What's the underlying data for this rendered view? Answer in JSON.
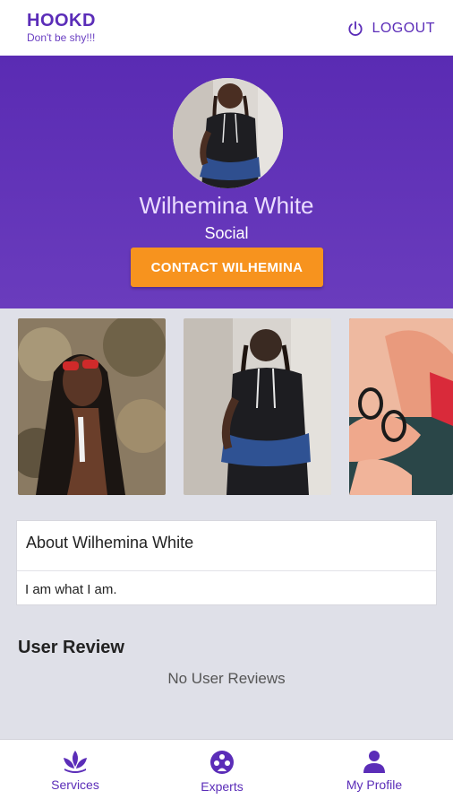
{
  "app": {
    "title": "HOOKD",
    "tagline": "Don't be shy!!!",
    "logout_label": "LOGOUT"
  },
  "profile": {
    "name": "Wilhemina White",
    "category": "Social",
    "contact_button": "CONTACT WILHEMINA"
  },
  "about": {
    "title": "About Wilhemina White",
    "text": "I am what I am."
  },
  "reviews": {
    "heading": "User Review",
    "empty_text": "No User Reviews"
  },
  "nav": {
    "items": [
      {
        "label": "Services",
        "icon": "lotus-icon"
      },
      {
        "label": "Experts",
        "icon": "group-icon"
      },
      {
        "label": "My Profile",
        "icon": "person-icon"
      }
    ]
  },
  "colors": {
    "brand": "#5b2db8",
    "hero": "#5a2bb3",
    "accent": "#f7931e",
    "background": "#dfe0e8"
  }
}
